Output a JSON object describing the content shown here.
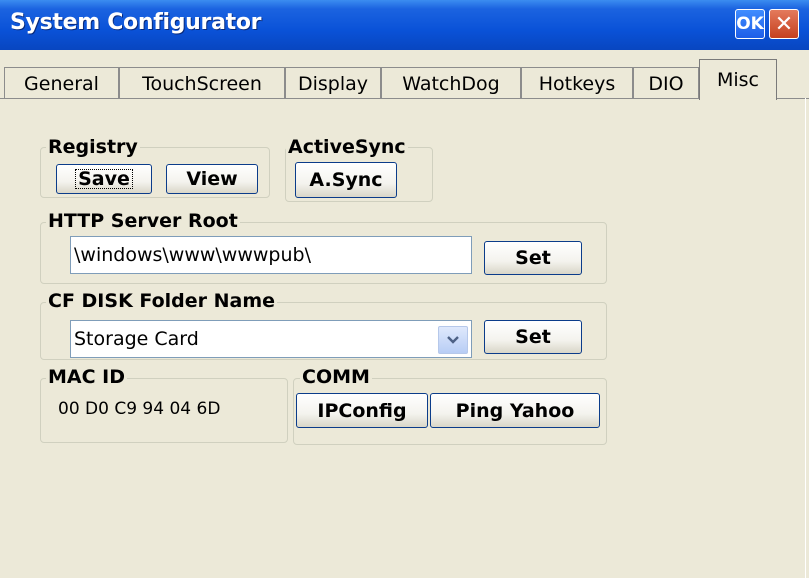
{
  "window": {
    "title": "System Configurator",
    "ok_label": "OK",
    "close_glyph": "✕"
  },
  "tabs": [
    "General",
    "TouchScreen",
    "Display",
    "WatchDog",
    "Hotkeys",
    "DIO",
    "Misc"
  ],
  "active_tab": "Misc",
  "registry": {
    "label": "Registry",
    "save": "Save",
    "view": "View"
  },
  "activesync": {
    "label": "ActiveSync",
    "button": "A.Sync"
  },
  "http": {
    "label": "HTTP Server Root",
    "value": "\\windows\\www\\wwwpub\\",
    "set": "Set"
  },
  "cfdisk": {
    "label": "CF DISK Folder Name",
    "value": "Storage Card",
    "set": "Set"
  },
  "mac": {
    "label": "MAC ID",
    "value": "00 D0 C9 94 04 6D"
  },
  "comm": {
    "label": "COMM",
    "ipconfig": "IPConfig",
    "ping": "Ping Yahoo"
  },
  "icons": {
    "dropdown": "chevron-down-icon",
    "close": "close-icon"
  }
}
